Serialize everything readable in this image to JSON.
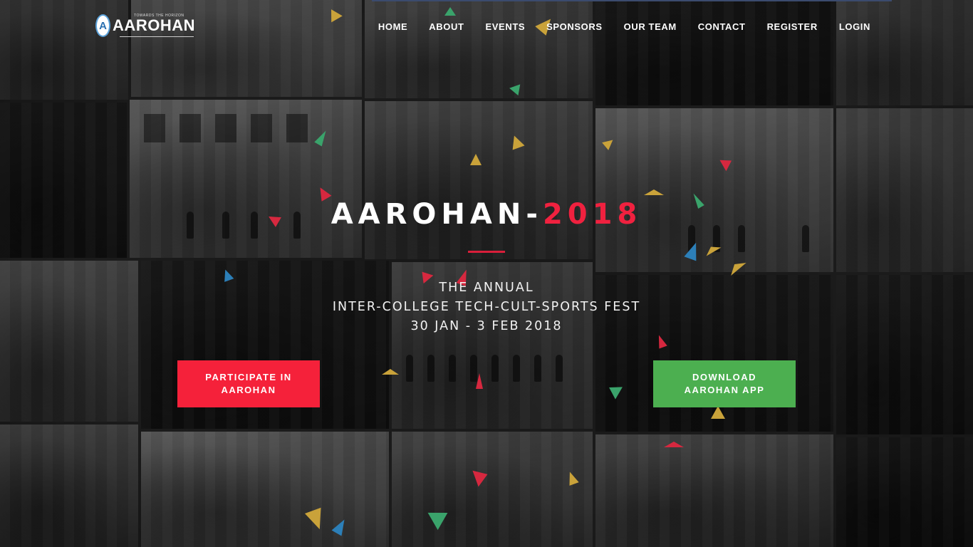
{
  "logo": {
    "text": "AAROHAN",
    "tagline": "TOWARDS THE HORIZON",
    "badge": "A"
  },
  "nav": {
    "items": [
      {
        "label": "HOME"
      },
      {
        "label": "ABOUT"
      },
      {
        "label": "EVENTS"
      },
      {
        "label": "SPONSORS"
      },
      {
        "label": "OUR TEAM"
      },
      {
        "label": "CONTACT"
      },
      {
        "label": "REGISTER"
      },
      {
        "label": "LOGIN"
      }
    ]
  },
  "hero": {
    "title_name": "AAROHAN",
    "title_dash": "-",
    "title_year": "2018",
    "line1": "THE ANNUAL",
    "line2": "INTER-COLLEGE TECH-CULT-SPORTS FEST",
    "line3": "30 JAN - 3 FEB 2018"
  },
  "buttons": {
    "participate": "PARTICIPATE IN\nAAROHAN",
    "download": "DOWNLOAD\nAAROHAN APP"
  },
  "colors": {
    "accent_red": "#f5213a",
    "accent_green": "#4caf50",
    "year_red": "#f0213f"
  }
}
